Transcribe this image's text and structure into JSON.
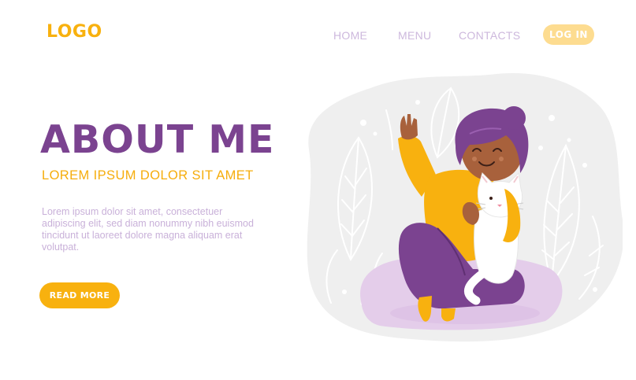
{
  "header": {
    "logo": "LOGO",
    "nav": {
      "home": "HOME",
      "menu": "MENU",
      "contacts": "CONTACTS"
    },
    "login_label": "LOG IN"
  },
  "hero": {
    "title": "ABOUT ME",
    "subtitle": "LOREM IPSUM DOLOR SIT AMET",
    "body": "Lorem ipsum dolor sit amet, consectetuer adipiscing elit, sed diam nonummy nibh euismod tincidunt ut laoreet dolore magna aliquam erat volutpat.",
    "cta_label": "READ MORE"
  },
  "colors": {
    "accent_yellow": "#f8b10f",
    "purple": "#7b4390",
    "lavender_text": "#c9b1d9",
    "nav_text": "#cdb8dd",
    "login_bg": "#fddc90",
    "blob_grey": "#efefef",
    "cushion": "#e4cdea"
  },
  "illustration": {
    "subject": "girl-holding-cat"
  }
}
